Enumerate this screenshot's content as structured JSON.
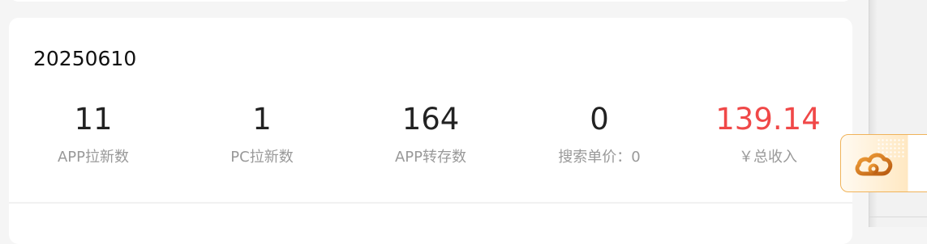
{
  "card": {
    "date": "20250610",
    "stats": [
      {
        "value": "11",
        "label": "APP拉新数"
      },
      {
        "value": "1",
        "label": "PC拉新数"
      },
      {
        "value": "164",
        "label": "APP转存数"
      },
      {
        "value": "0",
        "label": "搜索单价：0"
      },
      {
        "value": "139.14",
        "label": "￥总收入"
      }
    ]
  },
  "colors": {
    "accent_red": "#f04848",
    "label_gray": "#999999",
    "cloud_orange": "#d9791a"
  },
  "widget": {
    "icon": "cloud-icon"
  }
}
